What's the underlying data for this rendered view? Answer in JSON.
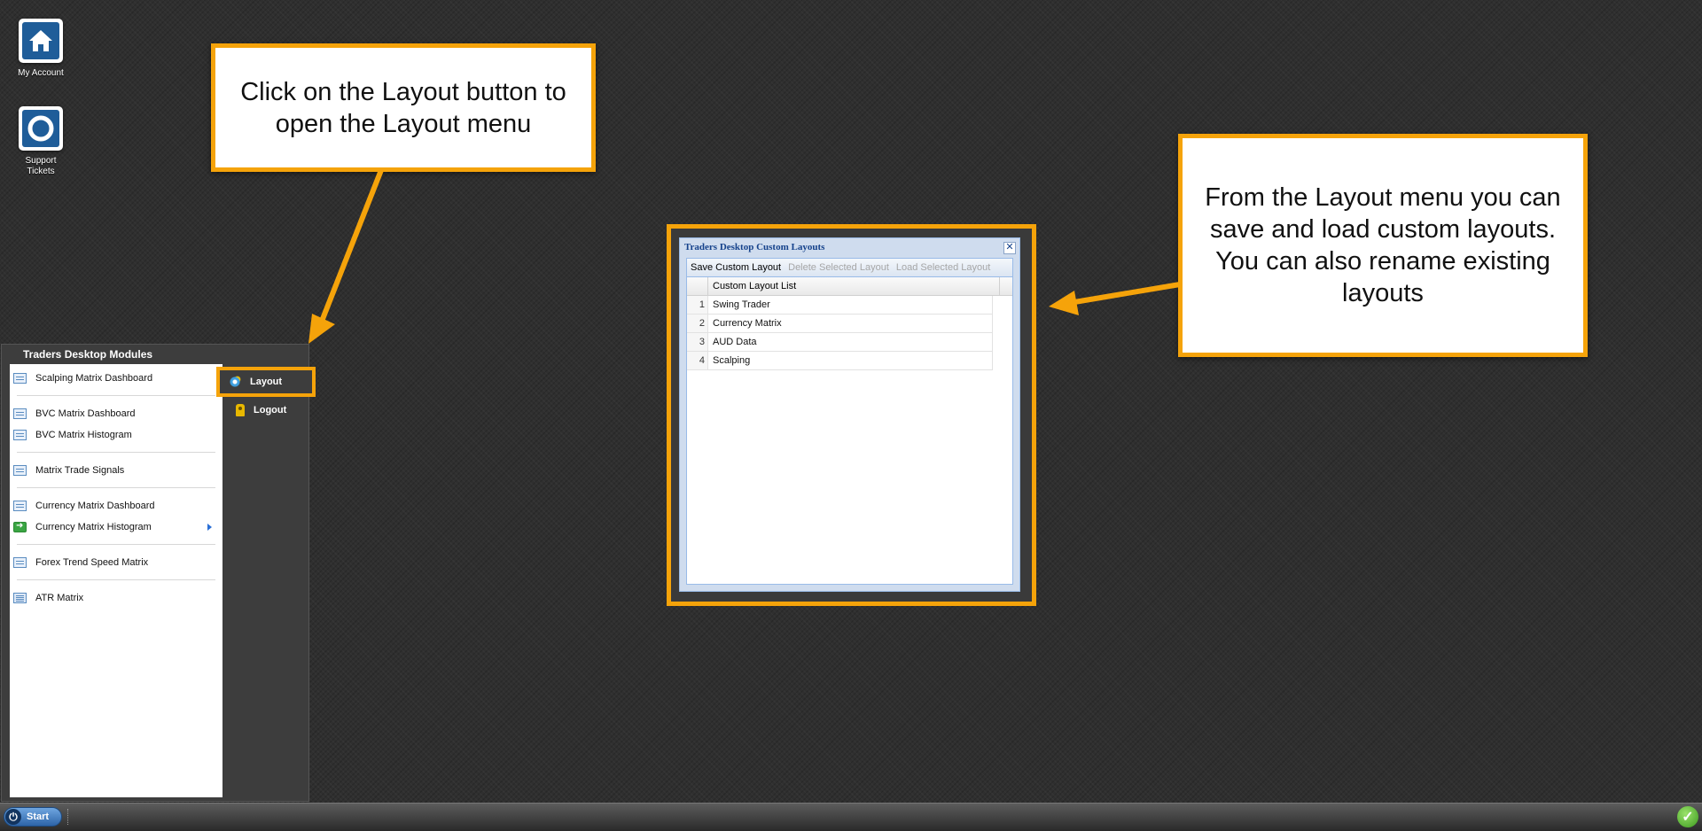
{
  "desktop_icons": [
    {
      "label": "My Account",
      "icon": "home-icon"
    },
    {
      "label": "Support Tickets",
      "icon": "lifebuoy-icon"
    }
  ],
  "callouts": {
    "layout_button": "Click on the Layout button to open the Layout menu",
    "layout_menu": "From the Layout menu you can save and load custom layouts. You can also rename existing layouts"
  },
  "start_menu": {
    "title": "Traders Desktop Modules",
    "modules": [
      {
        "label": "Scalping Matrix Dashboard"
      },
      {
        "label": "BVC Matrix Dashboard"
      },
      {
        "label": "BVC Matrix Histogram"
      },
      {
        "label": "Matrix Trade Signals"
      },
      {
        "label": "Currency Matrix Dashboard"
      },
      {
        "label": "Currency Matrix Histogram"
      },
      {
        "label": "Forex Trend Speed Matrix"
      },
      {
        "label": "ATR Matrix"
      }
    ],
    "actions": {
      "layout": "Layout",
      "logout": "Logout"
    }
  },
  "taskbar": {
    "start_label": "Start"
  },
  "dialog": {
    "title": "Traders Desktop Custom Layouts",
    "toolbar": {
      "save": "Save Custom Layout",
      "delete": "Delete Selected Layout",
      "load": "Load Selected Layout"
    },
    "grid": {
      "column": "Custom Layout List",
      "rows": [
        {
          "num": "1",
          "name": "Swing Trader"
        },
        {
          "num": "2",
          "name": "Currency Matrix"
        },
        {
          "num": "3",
          "name": "AUD Data"
        },
        {
          "num": "4",
          "name": "Scalping"
        }
      ]
    }
  },
  "colors": {
    "accent": "#f5a30a",
    "title_blue": "#15428b"
  }
}
